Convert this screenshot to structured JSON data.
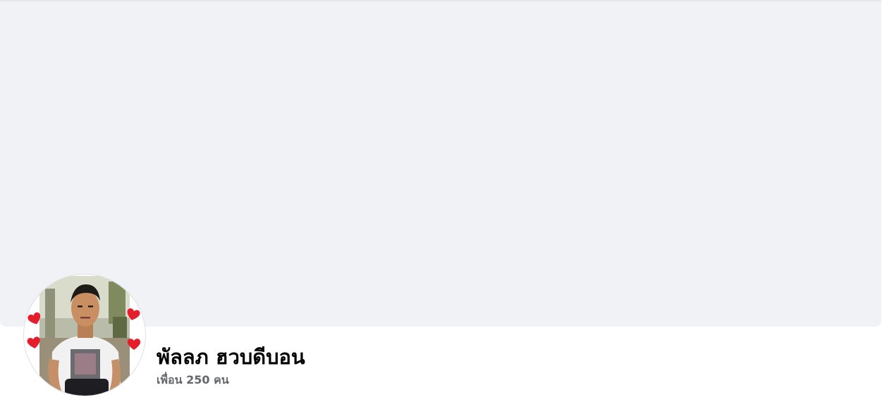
{
  "profile": {
    "name": "พัลลภ ฮวบดีบอน",
    "friends_count": "เพื่อน 250 คน",
    "avatar_icon": "profile-photo-with-hearts"
  },
  "colors": {
    "cover_bg": "#f0f2f5",
    "name_text": "#050505",
    "secondary_text": "#65676b",
    "heart": "#e41e2b"
  }
}
